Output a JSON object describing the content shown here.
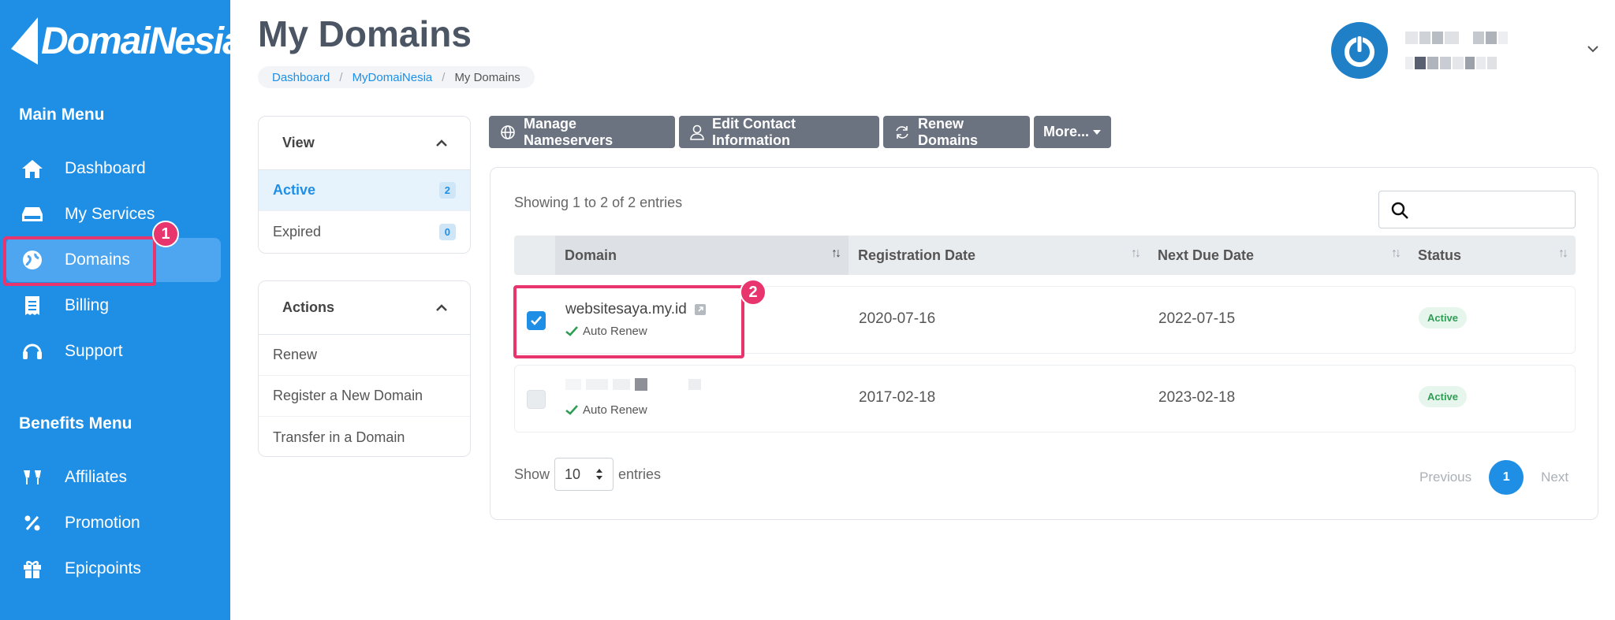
{
  "brand": {
    "logo_text": "DomaiNesia"
  },
  "page": {
    "title": "My Domains"
  },
  "breadcrumb": [
    "Dashboard",
    "MyDomaiNesia",
    "My Domains"
  ],
  "sidebar": {
    "main_heading": "Main Menu",
    "main_items": [
      {
        "label": "Dashboard",
        "icon": "home-icon"
      },
      {
        "label": "My Services",
        "icon": "server-icon"
      },
      {
        "label": "Domains",
        "icon": "globe-icon",
        "active": true
      },
      {
        "label": "Billing",
        "icon": "receipt-icon"
      },
      {
        "label": "Support",
        "icon": "headset-icon"
      }
    ],
    "benefits_heading": "Benefits Menu",
    "benefit_items": [
      {
        "label": "Affiliates",
        "icon": "cheers-icon"
      },
      {
        "label": "Promotion",
        "icon": "percent-icon"
      },
      {
        "label": "Epicpoints",
        "icon": "gift-icon"
      }
    ]
  },
  "annotations": {
    "step1": "1",
    "step2": "2"
  },
  "view_panel": {
    "heading": "View",
    "items": [
      {
        "label": "Active",
        "count": "2"
      },
      {
        "label": "Expired",
        "count": "0"
      }
    ]
  },
  "actions_panel": {
    "heading": "Actions",
    "items": [
      "Renew",
      "Register a New Domain",
      "Transfer in a Domain"
    ]
  },
  "toolbar": {
    "buttons": [
      "Manage Nameservers",
      "Edit Contact Information",
      "Renew Domains",
      "More..."
    ]
  },
  "table": {
    "showing": "Showing 1 to 2 of 2 entries",
    "columns": [
      "Domain",
      "Registration Date",
      "Next Due Date",
      "Status"
    ],
    "rows": [
      {
        "domain": "websitesaya.my.id",
        "auto_renew": "Auto Renew",
        "registration_date": "2020-07-16",
        "next_due_date": "2022-07-15",
        "status": "Active",
        "checked": true
      },
      {
        "domain": "",
        "auto_renew": "Auto Renew",
        "registration_date": "2017-02-18",
        "next_due_date": "2023-02-18",
        "status": "Active",
        "checked": false
      }
    ]
  },
  "length_control": {
    "prefix": "Show",
    "value": "10",
    "suffix": "entries"
  },
  "pagination": {
    "previous": "Previous",
    "current": "1",
    "next": "Next"
  },
  "colors": {
    "sidebar": "#1f8fe6",
    "accent": "#1f8fe6",
    "highlight": "#e8356d",
    "button": "#6b7280"
  }
}
